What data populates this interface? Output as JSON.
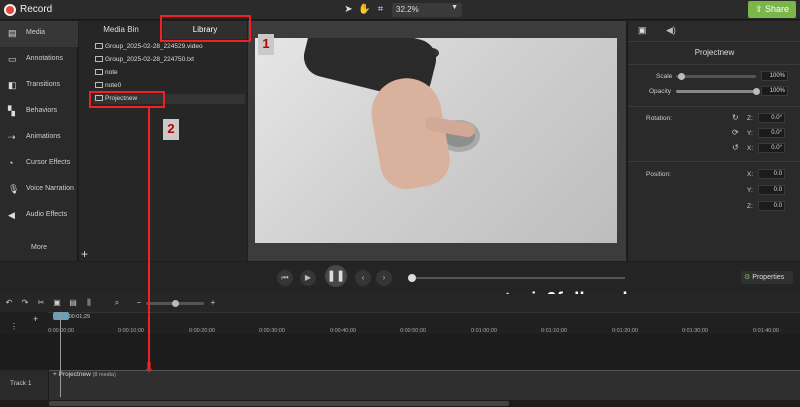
{
  "topbar": {
    "record_label": "Record",
    "zoom": "32.2%",
    "share_label": "Share"
  },
  "sidebar": {
    "items": [
      {
        "label": "Media",
        "icon": "film-icon"
      },
      {
        "label": "Annotations",
        "icon": "annotation-icon"
      },
      {
        "label": "Transitions",
        "icon": "transition-icon"
      },
      {
        "label": "Behaviors",
        "icon": "behaviors-icon"
      },
      {
        "label": "Animations",
        "icon": "animation-icon"
      },
      {
        "label": "Cursor Effects",
        "icon": "cursor-icon"
      },
      {
        "label": "Voice Narration",
        "icon": "microphone-icon"
      },
      {
        "label": "Audio Effects",
        "icon": "speaker-icon"
      }
    ],
    "more_label": "More"
  },
  "media": {
    "tabs": [
      "Media Bin",
      "Library"
    ],
    "files": [
      "Group_2025-02-28_224529.video",
      "Group_2025-02-28_224750.txt",
      "note",
      "note0",
      "Projectnew"
    ]
  },
  "properties": {
    "title": "Projectnew",
    "scale_label": "Scale",
    "scale_value": "100%",
    "opacity_label": "Opacity",
    "opacity_value": "100%",
    "rotation_label": "Rotation:",
    "rot_z": "0.0°",
    "rot_y": "0.0°",
    "rot_x": "0.0°",
    "position_label": "Position:",
    "pos_x": "0.0",
    "pos_y": "0.0",
    "pos_z": "0.0",
    "axis_z": "Z:",
    "axis_y": "Y:",
    "axis_x": "X:",
    "properties_button": "Properties"
  },
  "timeline": {
    "playhead_time": "0:00:01;29",
    "ticks": [
      "0:00:00;00",
      "0:00:10;00",
      "0:00:20;00",
      "0:00:30;00",
      "0:00:40;00",
      "0:00:50;00",
      "0:01:00;00",
      "0:01:10;00",
      "0:01:20;00",
      "0:01:30;00",
      "0:01:40;00"
    ],
    "track_label": "Track 1",
    "clip_title": "Projectnew",
    "clip_sub": "(8 media)"
  },
  "annotations": {
    "badge1": "1",
    "badge2": "2"
  },
  "watermark": "camtasia9fullcrack.org",
  "colors": {
    "accent_green": "#7ab648",
    "annotation_red": "#e22222"
  }
}
